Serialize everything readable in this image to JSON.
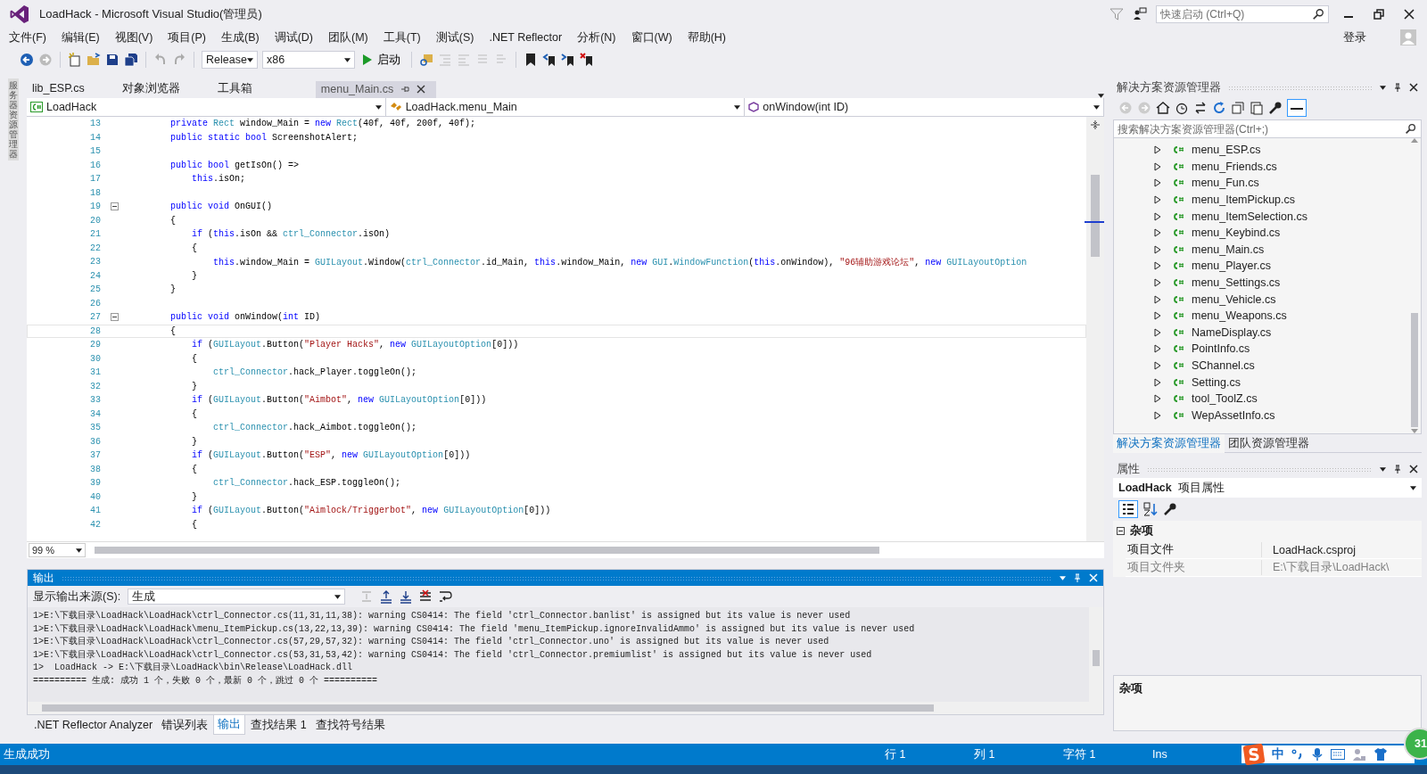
{
  "window": {
    "title": "LoadHack - Microsoft Visual Studio(管理员)",
    "quick_launch_placeholder": "快速启动 (Ctrl+Q)",
    "sign_in": "登录"
  },
  "menu": [
    "文件(F)",
    "编辑(E)",
    "视图(V)",
    "项目(P)",
    "生成(B)",
    "调试(D)",
    "团队(M)",
    "工具(T)",
    "测试(S)",
    ".NET Reflector",
    "分析(N)",
    "窗口(W)",
    "帮助(H)"
  ],
  "toolbar": {
    "configuration": "Release",
    "platform": "x86",
    "start": "启动"
  },
  "left_strip": "服务器资源管理器",
  "doc_tabs": [
    {
      "label": "lib_ESP.cs",
      "selected": false
    },
    {
      "label": "对象浏览器",
      "selected": false
    },
    {
      "label": "工具箱",
      "selected": false
    },
    {
      "label": "menu_Main.cs",
      "selected": true
    }
  ],
  "nav": [
    "LoadHack",
    "LoadHack.menu_Main",
    "onWindow(int ID)"
  ],
  "code": [
    {
      "n": "13",
      "fold": false,
      "current": false,
      "seg": [
        {
          "t": "        private ",
          "kind": "kw"
        },
        {
          "t": "Rect",
          "kind": "type"
        },
        {
          "t": " window_Main = ",
          "kind": "p"
        },
        {
          "t": "new ",
          "kind": "kw"
        },
        {
          "t": "Rect",
          "kind": "type"
        },
        {
          "t": "(40f, 40f, 200f, 40f);",
          "kind": "p"
        }
      ]
    },
    {
      "n": "14",
      "fold": false,
      "current": false,
      "seg": [
        {
          "t": "        public static bool ",
          "kind": "kw"
        },
        {
          "t": "ScreenshotAlert;",
          "kind": "p"
        }
      ]
    },
    {
      "n": "15",
      "fold": false,
      "current": false
    },
    {
      "n": "16",
      "fold": false,
      "current": false,
      "seg": [
        {
          "t": "        public bool ",
          "kind": "kw"
        },
        {
          "t": "getIsOn() =>",
          "kind": "p"
        }
      ]
    },
    {
      "n": "17",
      "fold": false,
      "current": false,
      "seg": [
        {
          "t": "            this",
          "kind": "kw"
        },
        {
          "t": ".isOn;",
          "kind": "p"
        }
      ]
    },
    {
      "n": "18",
      "fold": false,
      "current": false
    },
    {
      "n": "19",
      "fold": true,
      "current": false,
      "seg": [
        {
          "t": "        public void ",
          "kind": "kw"
        },
        {
          "t": "OnGUI()",
          "kind": "p"
        }
      ]
    },
    {
      "n": "20",
      "fold": false,
      "current": false,
      "seg": [
        {
          "t": "        {",
          "kind": "p"
        }
      ]
    },
    {
      "n": "21",
      "fold": false,
      "current": false,
      "seg": [
        {
          "t": "            if ",
          "kind": "kw"
        },
        {
          "t": "(",
          "kind": "p"
        },
        {
          "t": "this",
          "kind": "kw"
        },
        {
          "t": ".isOn && ",
          "kind": "p"
        },
        {
          "t": "ctrl_Connector",
          "kind": "type"
        },
        {
          "t": ".isOn)",
          "kind": "p"
        }
      ]
    },
    {
      "n": "22",
      "fold": false,
      "current": false,
      "seg": [
        {
          "t": "            {",
          "kind": "p"
        }
      ]
    },
    {
      "n": "23",
      "fold": false,
      "current": false,
      "seg": [
        {
          "t": "                this",
          "kind": "kw"
        },
        {
          "t": ".window_Main = ",
          "kind": "p"
        },
        {
          "t": "GUILayout",
          "kind": "type"
        },
        {
          "t": ".Window(",
          "kind": "p"
        },
        {
          "t": "ctrl_Connector",
          "kind": "type"
        },
        {
          "t": ".id_Main, ",
          "kind": "p"
        },
        {
          "t": "this",
          "kind": "kw"
        },
        {
          "t": ".window_Main, ",
          "kind": "p"
        },
        {
          "t": "new ",
          "kind": "kw"
        },
        {
          "t": "GUI",
          "kind": "type"
        },
        {
          "t": ".",
          "kind": "p"
        },
        {
          "t": "WindowFunction",
          "kind": "type"
        },
        {
          "t": "(",
          "kind": "p"
        },
        {
          "t": "this",
          "kind": "kw"
        },
        {
          "t": ".onWindow), ",
          "kind": "p"
        },
        {
          "t": "\"96辅助游戏论坛\"",
          "kind": "str"
        },
        {
          "t": ", ",
          "kind": "p"
        },
        {
          "t": "new ",
          "kind": "kw"
        },
        {
          "t": "GUILayoutOption",
          "kind": "type"
        }
      ]
    },
    {
      "n": "24",
      "fold": false,
      "current": false,
      "seg": [
        {
          "t": "            }",
          "kind": "p"
        }
      ]
    },
    {
      "n": "25",
      "fold": false,
      "current": false,
      "seg": [
        {
          "t": "        }",
          "kind": "p"
        }
      ]
    },
    {
      "n": "26",
      "fold": false,
      "current": false
    },
    {
      "n": "27",
      "fold": true,
      "current": false,
      "seg": [
        {
          "t": "        public void ",
          "kind": "kw"
        },
        {
          "t": "onWindow(",
          "kind": "p"
        },
        {
          "t": "int ",
          "kind": "kw"
        },
        {
          "t": "ID)",
          "kind": "p"
        }
      ]
    },
    {
      "n": "28",
      "fold": false,
      "current": true,
      "seg": [
        {
          "t": "        {",
          "kind": "p"
        }
      ]
    },
    {
      "n": "29",
      "fold": false,
      "current": false,
      "seg": [
        {
          "t": "            if ",
          "kind": "kw"
        },
        {
          "t": "(",
          "kind": "p"
        },
        {
          "t": "GUILayout",
          "kind": "type"
        },
        {
          "t": ".Button(",
          "kind": "p"
        },
        {
          "t": "\"Player Hacks\"",
          "kind": "str"
        },
        {
          "t": ", ",
          "kind": "p"
        },
        {
          "t": "new ",
          "kind": "kw"
        },
        {
          "t": "GUILayoutOption",
          "kind": "type"
        },
        {
          "t": "[0]))",
          "kind": "p"
        }
      ]
    },
    {
      "n": "30",
      "fold": false,
      "current": false,
      "seg": [
        {
          "t": "            {",
          "kind": "p"
        }
      ]
    },
    {
      "n": "31",
      "fold": false,
      "current": false,
      "seg": [
        {
          "t": "                ctrl_Connector",
          "kind": "type"
        },
        {
          "t": ".hack_Player.toggleOn();",
          "kind": "p"
        }
      ]
    },
    {
      "n": "32",
      "fold": false,
      "current": false,
      "seg": [
        {
          "t": "            }",
          "kind": "p"
        }
      ]
    },
    {
      "n": "33",
      "fold": false,
      "current": false,
      "seg": [
        {
          "t": "            if ",
          "kind": "kw"
        },
        {
          "t": "(",
          "kind": "p"
        },
        {
          "t": "GUILayout",
          "kind": "type"
        },
        {
          "t": ".Button(",
          "kind": "p"
        },
        {
          "t": "\"Aimbot\"",
          "kind": "str"
        },
        {
          "t": ", ",
          "kind": "p"
        },
        {
          "t": "new ",
          "kind": "kw"
        },
        {
          "t": "GUILayoutOption",
          "kind": "type"
        },
        {
          "t": "[0]))",
          "kind": "p"
        }
      ]
    },
    {
      "n": "34",
      "fold": false,
      "current": false,
      "seg": [
        {
          "t": "            {",
          "kind": "p"
        }
      ]
    },
    {
      "n": "35",
      "fold": false,
      "current": false,
      "seg": [
        {
          "t": "                ctrl_Connector",
          "kind": "type"
        },
        {
          "t": ".hack_Aimbot.toggleOn();",
          "kind": "p"
        }
      ]
    },
    {
      "n": "36",
      "fold": false,
      "current": false,
      "seg": [
        {
          "t": "            }",
          "kind": "p"
        }
      ]
    },
    {
      "n": "37",
      "fold": false,
      "current": false,
      "seg": [
        {
          "t": "            if ",
          "kind": "kw"
        },
        {
          "t": "(",
          "kind": "p"
        },
        {
          "t": "GUILayout",
          "kind": "type"
        },
        {
          "t": ".Button(",
          "kind": "p"
        },
        {
          "t": "\"ESP\"",
          "kind": "str"
        },
        {
          "t": ", ",
          "kind": "p"
        },
        {
          "t": "new ",
          "kind": "kw"
        },
        {
          "t": "GUILayoutOption",
          "kind": "type"
        },
        {
          "t": "[0]))",
          "kind": "p"
        }
      ]
    },
    {
      "n": "38",
      "fold": false,
      "current": false,
      "seg": [
        {
          "t": "            {",
          "kind": "p"
        }
      ]
    },
    {
      "n": "39",
      "fold": false,
      "current": false,
      "seg": [
        {
          "t": "                ctrl_Connector",
          "kind": "type"
        },
        {
          "t": ".hack_ESP.toggleOn();",
          "kind": "p"
        }
      ]
    },
    {
      "n": "40",
      "fold": false,
      "current": false,
      "seg": [
        {
          "t": "            }",
          "kind": "p"
        }
      ]
    },
    {
      "n": "41",
      "fold": false,
      "current": false,
      "seg": [
        {
          "t": "            if ",
          "kind": "kw"
        },
        {
          "t": "(",
          "kind": "p"
        },
        {
          "t": "GUILayout",
          "kind": "type"
        },
        {
          "t": ".Button(",
          "kind": "p"
        },
        {
          "t": "\"Aimlock/Triggerbot\"",
          "kind": "str"
        },
        {
          "t": ", ",
          "kind": "p"
        },
        {
          "t": "new ",
          "kind": "kw"
        },
        {
          "t": "GUILayoutOption",
          "kind": "type"
        },
        {
          "t": "[0]))",
          "kind": "p"
        }
      ]
    },
    {
      "n": "42",
      "fold": false,
      "current": false,
      "seg": [
        {
          "t": "            {",
          "kind": "p"
        }
      ]
    }
  ],
  "zoom": "99 %",
  "output": {
    "title": "输出",
    "source_label": "显示输出来源(S):",
    "source": "生成",
    "lines": [
      "1>E:\\下载目录\\LoadHack\\LoadHack\\ctrl_Connector.cs(11,31,11,38): warning CS0414: The field 'ctrl_Connector.banlist' is assigned but its value is never used",
      "1>E:\\下载目录\\LoadHack\\LoadHack\\menu_ItemPickup.cs(13,22,13,39): warning CS0414: The field 'menu_ItemPickup.ignoreInvalidAmmo' is assigned but its value is never used",
      "1>E:\\下载目录\\LoadHack\\LoadHack\\ctrl_Connector.cs(57,29,57,32): warning CS0414: The field 'ctrl_Connector.uno' is assigned but its value is never used",
      "1>E:\\下载目录\\LoadHack\\LoadHack\\ctrl_Connector.cs(53,31,53,42): warning CS0414: The field 'ctrl_Connector.premiumlist' is assigned but its value is never used",
      "1>  LoadHack -> E:\\下载目录\\LoadHack\\bin\\Release\\LoadHack.dll",
      "========== 生成: 成功 1 个，失败 0 个，最新 0 个，跳过 0 个 =========="
    ]
  },
  "bottom_tabs": [
    {
      "label": ".NET Reflector Analyzer",
      "selected": false
    },
    {
      "label": "错误列表",
      "selected": false
    },
    {
      "label": "输出",
      "selected": true
    },
    {
      "label": "查找结果 1",
      "selected": false
    },
    {
      "label": "查找符号结果",
      "selected": false
    }
  ],
  "solution_explorer": {
    "title": "解决方案资源管理器",
    "search_placeholder": "搜索解决方案资源管理器(Ctrl+;)",
    "files": [
      "menu_ESP.cs",
      "menu_Friends.cs",
      "menu_Fun.cs",
      "menu_ItemPickup.cs",
      "menu_ItemSelection.cs",
      "menu_Keybind.cs",
      "menu_Main.cs",
      "menu_Player.cs",
      "menu_Settings.cs",
      "menu_Vehicle.cs",
      "menu_Weapons.cs",
      "NameDisplay.cs",
      "PointInfo.cs",
      "SChannel.cs",
      "Setting.cs",
      "tool_ToolZ.cs",
      "WepAssetInfo.cs"
    ],
    "tabs": [
      {
        "label": "解决方案资源管理器",
        "selected": true
      },
      {
        "label": "团队资源管理器",
        "selected": false
      }
    ]
  },
  "properties": {
    "title": "属性",
    "object": "LoadHack",
    "object_type": "项目属性",
    "category": "杂项",
    "rows": [
      {
        "name": "项目文件",
        "value": "LoadHack.csproj",
        "disabled": false
      },
      {
        "name": "项目文件夹",
        "value": "E:\\下载目录\\LoadHack\\",
        "disabled": true
      }
    ],
    "description": "杂项"
  },
  "status_bar": {
    "message": "生成成功",
    "line": "行 1",
    "column": "列 1",
    "char": "字符 1",
    "mode": "Ins",
    "ime": "中",
    "badge": "31"
  }
}
